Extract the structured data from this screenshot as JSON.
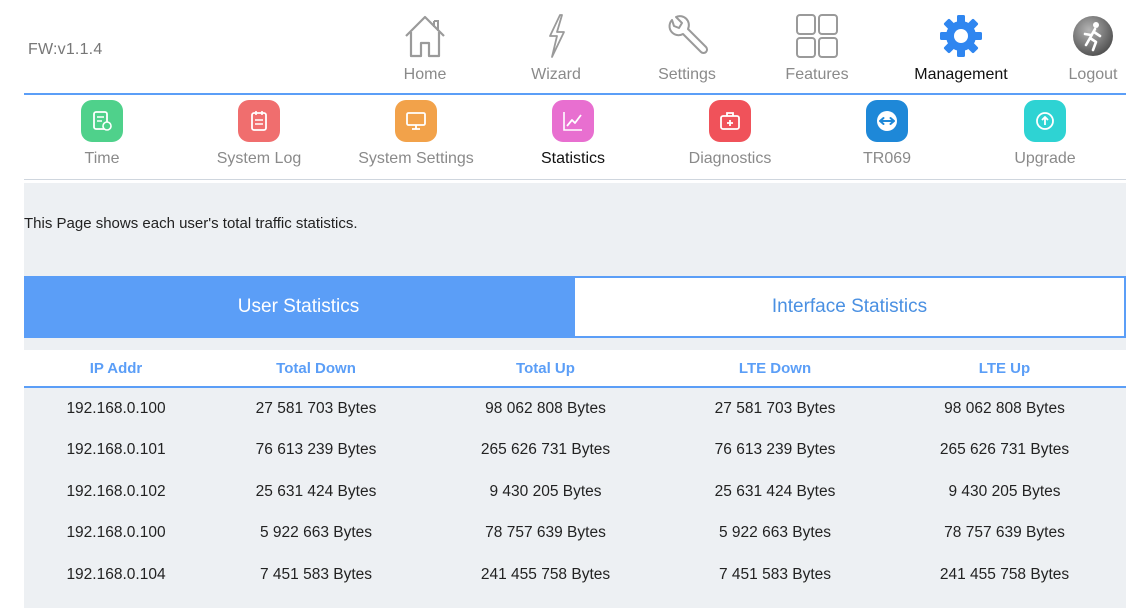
{
  "header": {
    "firmware": "FW:v1.1.4",
    "nav": [
      {
        "label": "Home",
        "icon": "home-icon"
      },
      {
        "label": "Wizard",
        "icon": "wizard-icon"
      },
      {
        "label": "Settings",
        "icon": "wrench-icon"
      },
      {
        "label": "Features",
        "icon": "grid-icon"
      },
      {
        "label": "Management",
        "icon": "gear-icon",
        "active": true
      },
      {
        "label": "Logout",
        "icon": "logout-icon"
      }
    ]
  },
  "subnav": [
    {
      "label": "Time",
      "icon": "time-icon",
      "color": "#4fd18b"
    },
    {
      "label": "System Log",
      "icon": "system-log-icon",
      "color": "#f06e6e"
    },
    {
      "label": "System Settings",
      "icon": "monitor-icon",
      "color": "#f2a24a"
    },
    {
      "label": "Statistics",
      "icon": "chart-icon",
      "color": "#e86fd0",
      "active": true
    },
    {
      "label": "Diagnostics",
      "icon": "toolbox-icon",
      "color": "#f0525a"
    },
    {
      "label": "TR069",
      "icon": "tr069-icon",
      "color": "#1e88d8"
    },
    {
      "label": "Upgrade",
      "icon": "upgrade-icon",
      "color": "#2ed3d3"
    }
  ],
  "content": {
    "description": "This Page shows each user's total traffic statistics.",
    "tabs": [
      {
        "label": "User Statistics",
        "active": true
      },
      {
        "label": "Interface Statistics",
        "active": false
      }
    ],
    "table": {
      "headers": [
        "IP Addr",
        "Total Down",
        "Total Up",
        "LTE Down",
        "LTE Up"
      ],
      "rows": [
        [
          "192.168.0.100",
          "27 581 703 Bytes",
          "98 062 808 Bytes",
          "27 581 703 Bytes",
          "98 062 808 Bytes"
        ],
        [
          "192.168.0.101",
          "76 613 239 Bytes",
          "265 626 731 Bytes",
          "76 613 239 Bytes",
          "265 626 731 Bytes"
        ],
        [
          "192.168.0.102",
          "25 631 424 Bytes",
          "9 430 205 Bytes",
          "25 631 424 Bytes",
          "9 430 205 Bytes"
        ],
        [
          "192.168.0.100",
          "5 922 663 Bytes",
          "78 757 639 Bytes",
          "5 922 663 Bytes",
          "78 757 639 Bytes"
        ],
        [
          "192.168.0.104",
          "7 451 583 Bytes",
          "241 455 758 Bytes",
          "7 451 583 Bytes",
          "241 455 758 Bytes"
        ]
      ]
    }
  },
  "colors": {
    "accent": "#5b9ef7",
    "content_bg": "#edf0f3"
  }
}
